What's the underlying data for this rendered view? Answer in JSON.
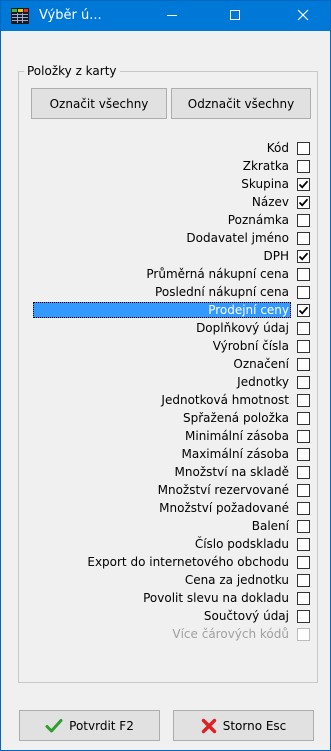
{
  "window": {
    "title": "Výběr ú..."
  },
  "group": {
    "legend": "Položky z karty",
    "select_all_label": "Označit všechny",
    "deselect_all_label": "Odznačit všechny",
    "items": [
      {
        "label": "Kód",
        "checked": false
      },
      {
        "label": "Zkratka",
        "checked": false
      },
      {
        "label": "Skupina",
        "checked": true
      },
      {
        "label": "Název",
        "checked": true
      },
      {
        "label": "Poznámka",
        "checked": false
      },
      {
        "label": "Dodavatel jméno",
        "checked": false
      },
      {
        "label": "DPH",
        "checked": true
      },
      {
        "label": "Průměrná nákupní cena",
        "checked": false
      },
      {
        "label": "Poslední nákupní cena",
        "checked": false
      },
      {
        "label": "Prodejní ceny",
        "checked": true,
        "selected": true
      },
      {
        "label": "Doplňkový údaj",
        "checked": false
      },
      {
        "label": "Výrobní čísla",
        "checked": false
      },
      {
        "label": "Označení",
        "checked": false
      },
      {
        "label": "Jednotky",
        "checked": false
      },
      {
        "label": "Jednotková hmotnost",
        "checked": false
      },
      {
        "label": "Spřažená položka",
        "checked": false
      },
      {
        "label": "Minimální zásoba",
        "checked": false
      },
      {
        "label": "Maximální zásoba",
        "checked": false
      },
      {
        "label": "Množství na skladě",
        "checked": false
      },
      {
        "label": "Množství rezervované",
        "checked": false
      },
      {
        "label": "Množství požadované",
        "checked": false
      },
      {
        "label": "Balení",
        "checked": false
      },
      {
        "label": "Číslo podskladu",
        "checked": false
      },
      {
        "label": "Export do internetového obchodu",
        "checked": false
      },
      {
        "label": "Cena za jednotku",
        "checked": false
      },
      {
        "label": "Povolit slevu na dokladu",
        "checked": false
      },
      {
        "label": "Součtový údaj",
        "checked": false
      },
      {
        "label": "Více čárových kódů",
        "checked": false,
        "disabled": true
      }
    ]
  },
  "footer": {
    "confirm_label": "Potvrdit F2",
    "cancel_label": "Storno Esc"
  },
  "icons": {
    "app": "app-icon",
    "minimize": "minimize-icon",
    "maximize": "maximize-icon",
    "close": "close-icon",
    "confirm": "checkmark-icon",
    "cancel": "red-x-icon"
  },
  "colors": {
    "titlebar": "#0078d7",
    "selection": "#3399ff",
    "confirm_icon": "#2f9e2f",
    "cancel_icon": "#e02020"
  }
}
